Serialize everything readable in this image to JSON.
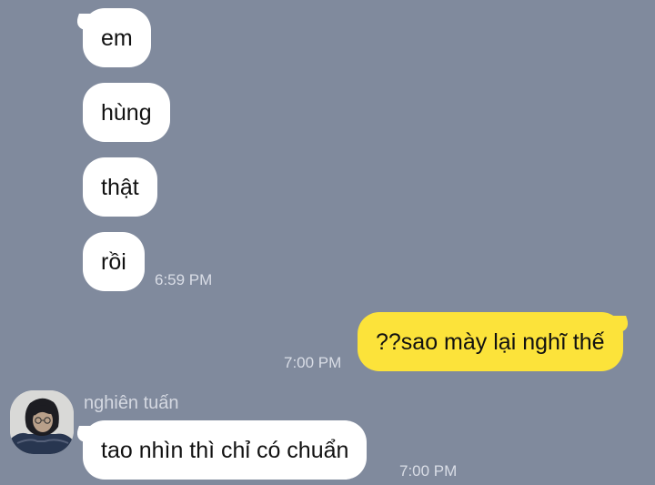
{
  "messages_in_group1": [
    {
      "text": "em"
    },
    {
      "text": "hùng"
    },
    {
      "text": "thật"
    },
    {
      "text": "rồi"
    }
  ],
  "group1_time": "6:59 PM",
  "outgoing": {
    "text": "??sao mày lại nghĩ thế",
    "time": "7:00 PM"
  },
  "incoming2": {
    "sender": "nghiên tuấn",
    "avatar_icon": "user-avatar-photo",
    "text": "tao nhìn thì chỉ có chuẩn",
    "time": "7:00 PM"
  },
  "colors": {
    "background": "#808a9d",
    "incoming_bubble": "#ffffff",
    "outgoing_bubble": "#fce33a"
  }
}
